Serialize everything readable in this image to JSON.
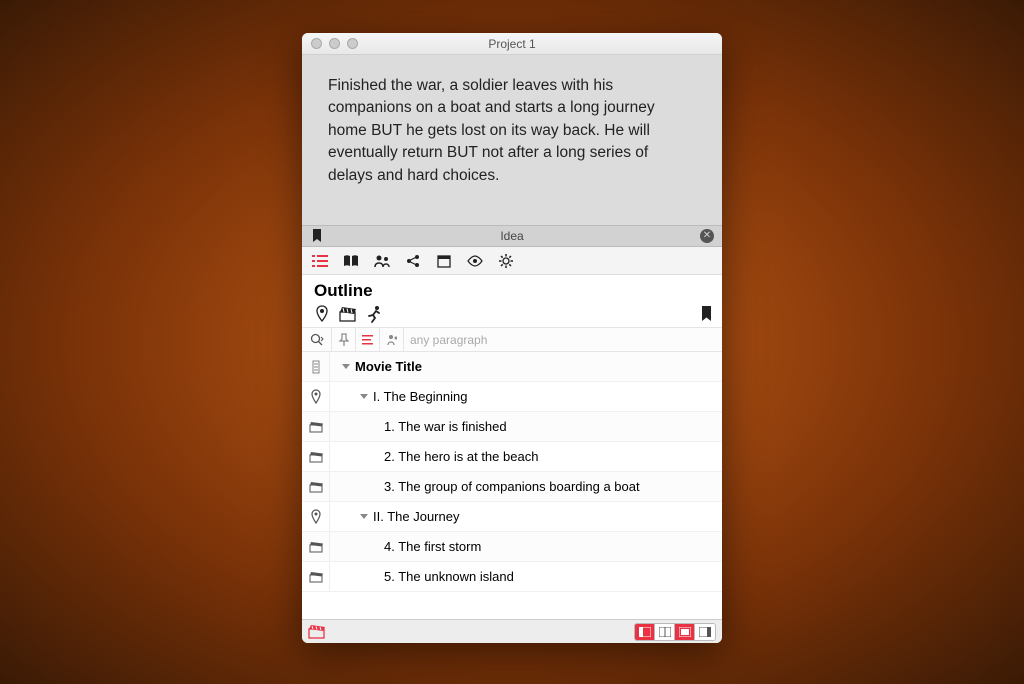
{
  "window": {
    "title": "Project 1"
  },
  "idea": {
    "text": "Finished the war, a soldier leaves with his companions on a boat and starts a long journey home BUT he gets lost on its way back. He will eventually return BUT not after a long series of delays and hard choices.",
    "label": "Idea"
  },
  "section": {
    "title": "Outline"
  },
  "filter": {
    "placeholder": "any paragraph"
  },
  "tree": {
    "movie_title": "Movie Title",
    "act1": "I. The Beginning",
    "s1": "1. The war is finished",
    "s2": "2. The hero is at the beach",
    "s3": "3. The group of companions boarding a boat",
    "act2": "II. The Journey",
    "s4": "4. The first storm",
    "s5": "5. The unknown island"
  },
  "colors": {
    "accent": "#e93244"
  }
}
